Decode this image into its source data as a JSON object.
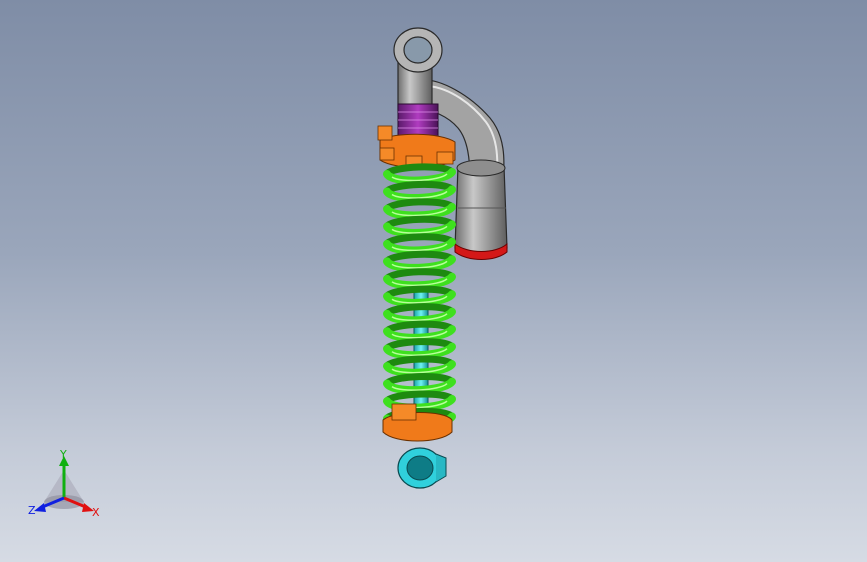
{
  "viewport": {
    "background_top": "#7f8da6",
    "background_bottom": "#d6dbe4"
  },
  "model": {
    "parts": [
      {
        "name": "top-mount-eye",
        "color": "#9c9c9c"
      },
      {
        "name": "reservoir-arm",
        "color": "#a4a4a4"
      },
      {
        "name": "reservoir-canister",
        "color": "#9d9d9d"
      },
      {
        "name": "reservoir-cap-ring",
        "color": "#d41818"
      },
      {
        "name": "preload-collar",
        "color": "#c81ec8"
      },
      {
        "name": "upper-spring-seat",
        "color": "#f07a1a"
      },
      {
        "name": "coil-spring",
        "color": "#3ee01e"
      },
      {
        "name": "piston-rod",
        "color": "#2fd4d8"
      },
      {
        "name": "lower-spring-seat",
        "color": "#f07a1a"
      },
      {
        "name": "bottom-mount-eye",
        "color": "#30d0dc"
      }
    ]
  },
  "triad": {
    "x_label": "X",
    "y_label": "Y",
    "z_label": "Z",
    "x_color": "#e01010",
    "y_color": "#10b010",
    "z_color": "#1020e0"
  }
}
